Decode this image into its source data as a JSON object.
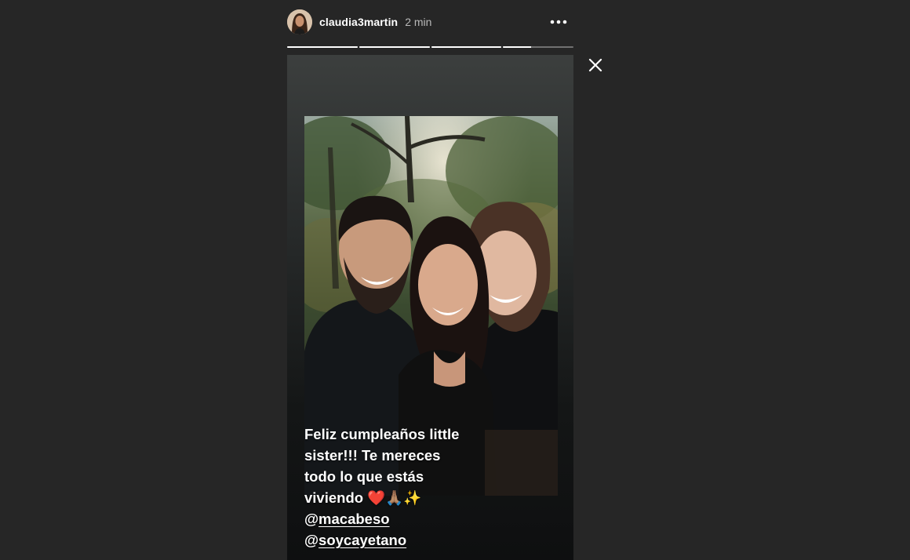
{
  "story": {
    "username": "claudia3martin",
    "time_ago": "2 min",
    "segments": [
      1,
      1,
      1,
      0.4
    ],
    "caption_lines": [
      "Feliz cumpleaños little",
      "sister!!! Te mereces",
      "todo lo que estás",
      "viviendo ❤️🙏🏽✨"
    ],
    "mentions": [
      {
        "at": "@",
        "handle": "macabeso"
      },
      {
        "at": "@",
        "handle": "soycayetano"
      }
    ]
  },
  "icons": {
    "more": "more-horizontal-icon",
    "close": "close-icon",
    "avatar": "avatar-photo"
  },
  "colors": {
    "background": "#262626",
    "text": "#ffffff",
    "muted": "#b9b9b9"
  }
}
